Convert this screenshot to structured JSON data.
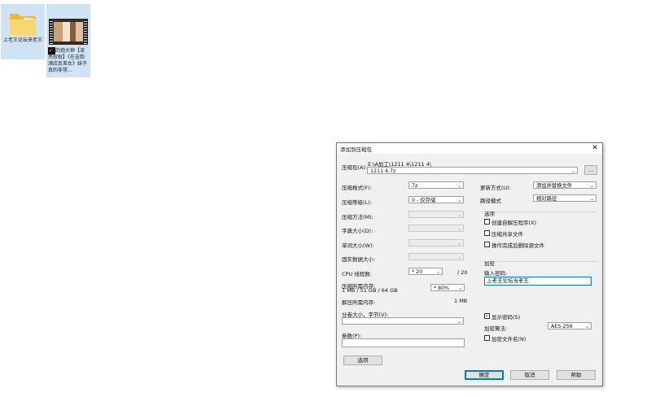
{
  "desktop": {
    "folder_icon": {
      "label": "上老王论坛来老王"
    },
    "video_icon": {
      "label": "的炮大神【深亮权权】《在吉韵酒店反差女》妹子真的非常..."
    }
  },
  "dialog": {
    "title": "添加到压缩包",
    "archive": {
      "label": "压缩包(A):",
      "path": "E:\\A加工\\1211 4\\1211 4\\",
      "name": "1211 4.7z",
      "browse_label": "..."
    },
    "left": {
      "format_label": "压缩格式(F):",
      "format_value": "7z",
      "level_label": "压缩等级(L):",
      "level_value": "0 - 仅存储",
      "method_label": "压缩方法(M):",
      "dict_label": "字典大小(D):",
      "word_label": "单词大小(W):",
      "solid_label": "固实数据大小:",
      "cpu_label": "CPU 线程数:",
      "cpu_value": "* 20",
      "cpu_max": "/ 20",
      "mem_label": "压缩所需内存:",
      "mem_detail": "1 MB / 51 GB / 64 GB",
      "mem_value": "* 80%",
      "decomp_label": "解压所需内存:",
      "decomp_value": "1 MB",
      "split_label": "分卷大小，字节(V):",
      "params_label": "参数(P):",
      "options_button": "选项"
    },
    "right": {
      "update_label": "更新方式(U):",
      "update_value": "添加并替换文件",
      "path_label": "路径模式",
      "path_value": "相对路径",
      "options_group": "选项",
      "options": [
        {
          "label": "创建自解压程序(X)",
          "checked": false
        },
        {
          "label": "压缩共享文件",
          "checked": false
        },
        {
          "label": "操作完成后删除源文件",
          "checked": false
        }
      ],
      "encrypt_group": "加密",
      "password_label": "输入密码:",
      "password_value": "上老王论坛当老王",
      "show_password_label": "显示密码(S)",
      "show_password_checked": true,
      "algo_label": "加密算法:",
      "algo_value": "AES-256",
      "encrypt_names_label": "加密文件名(N)",
      "encrypt_names_checked": false
    },
    "buttons": {
      "ok": "确定",
      "cancel": "取消",
      "help": "帮助"
    }
  }
}
